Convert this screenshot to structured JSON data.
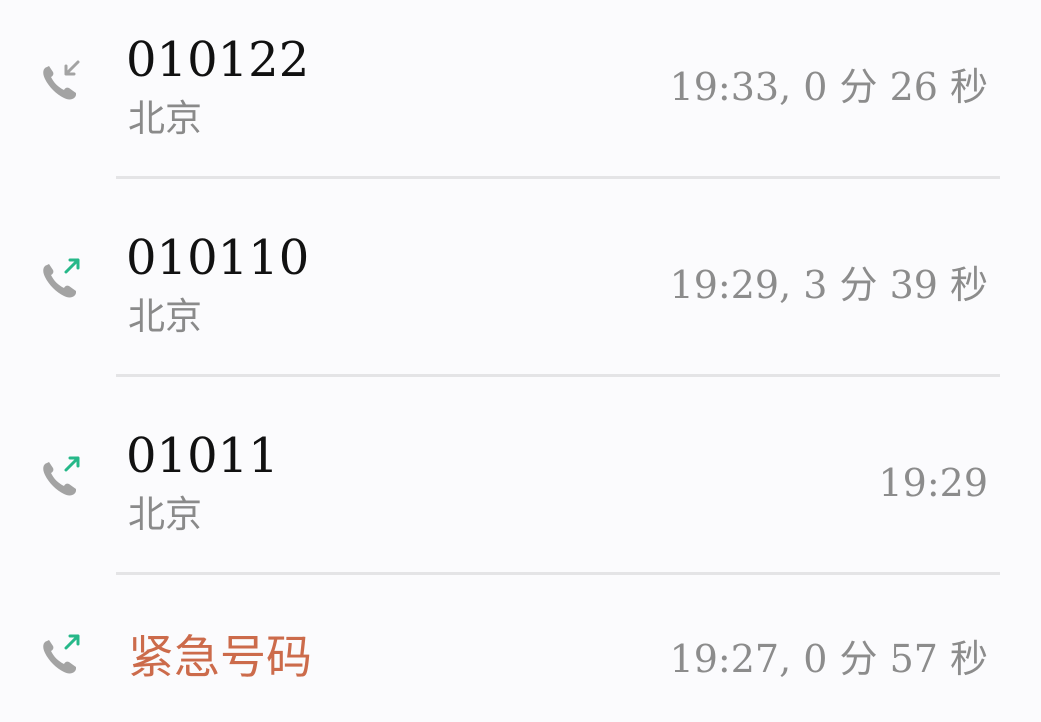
{
  "calls": [
    {
      "number": "010122",
      "location": "北京",
      "time_info": "19:33, 0 分 26 秒",
      "direction": "incoming",
      "icon": "incoming-call-icon"
    },
    {
      "number": "010110",
      "location": "北京",
      "time_info": "19:29, 3 分 39 秒",
      "direction": "outgoing",
      "icon": "outgoing-call-icon"
    },
    {
      "number": "01011",
      "location": "北京",
      "time_info": "19:29",
      "direction": "outgoing",
      "icon": "outgoing-call-icon"
    },
    {
      "label": "紧急号码",
      "time_info": "19:27, 0 分 57 秒",
      "direction": "outgoing",
      "icon": "outgoing-call-icon"
    }
  ],
  "colors": {
    "background": "#fbfbfd",
    "number_text": "#111111",
    "secondary_text": "#8a8a8a",
    "emergency_text": "#cc6b4b",
    "phone_icon": "#a3a3a3",
    "incoming_arrow": "#a3a3a3",
    "outgoing_arrow": "#26b889",
    "divider": "#e4e4e6"
  }
}
